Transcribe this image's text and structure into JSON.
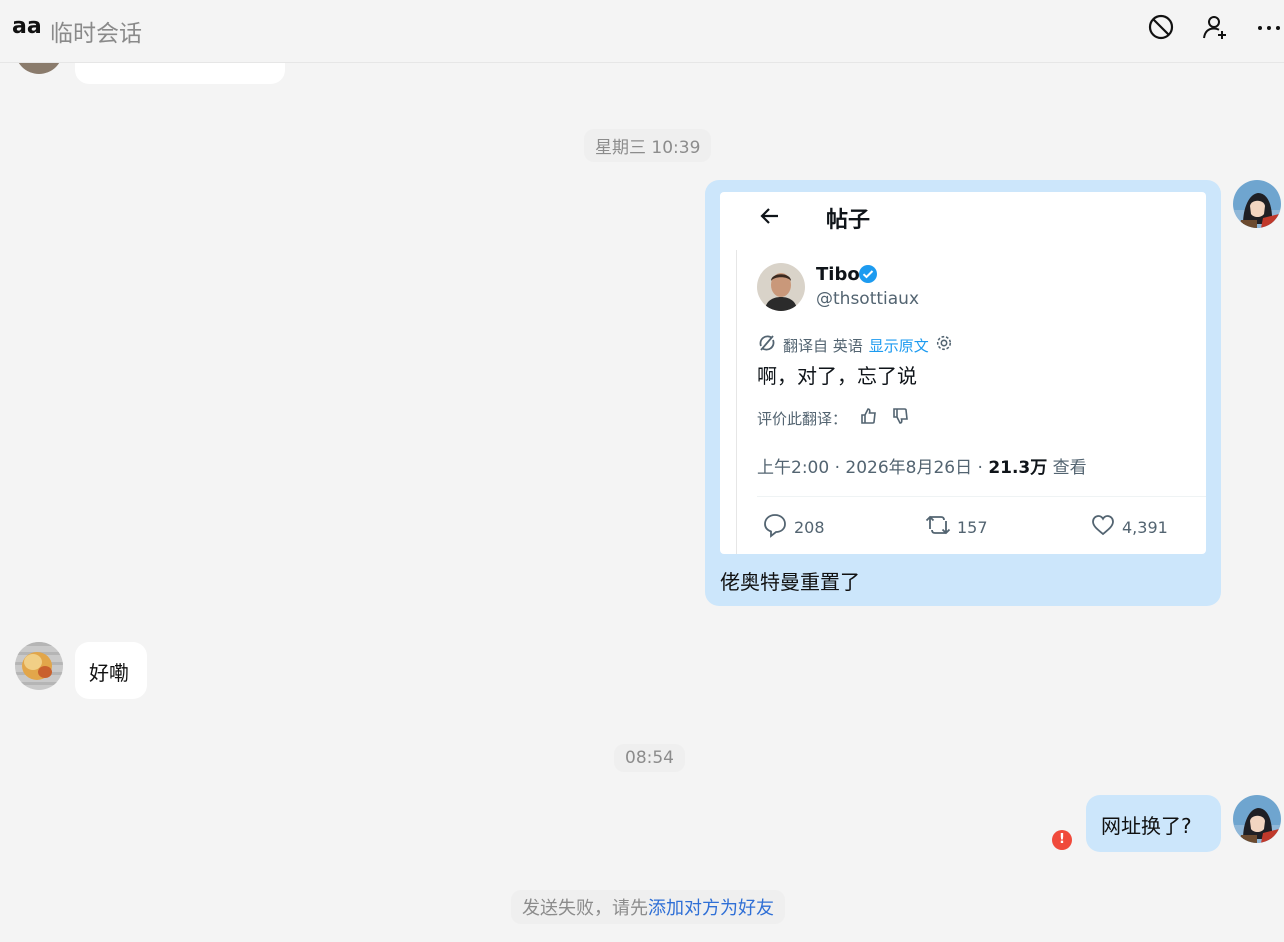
{
  "header": {
    "contact_name": "aa",
    "subtitle": "临时会话",
    "icons": [
      "block-icon",
      "add-friend-icon",
      "more-icon"
    ]
  },
  "messages": {
    "time_1": "星期三 10:39",
    "tweet_card": {
      "page_title": "帖子",
      "user_name": "Tibo",
      "handle": "@thsottiaux",
      "translated_from": "翻译自 英语",
      "show_original": "显示原文",
      "content": "啊，对了，忘了说",
      "rate_translation": "评价此翻译：",
      "meta_time": "上午2:00 · 2026年8月26日 · ",
      "views_count": "21.3万",
      "views_label": " 查看",
      "replies": "208",
      "retweets": "157",
      "likes": "4,391"
    },
    "outgoing_caption": "佬奥特曼重置了",
    "incoming_reply": "好嘞",
    "time_2": "08:54",
    "outgoing_last": "网址换了?",
    "error_mark": "!"
  },
  "notice": {
    "prefix": "发送失败，请先",
    "link": "添加对方为好友"
  },
  "colors": {
    "outgoing_bubble": "#cce6fb",
    "incoming_bubble": "#ffffff",
    "link_blue": "#1d9bf0",
    "error_red": "#f04a3b"
  }
}
